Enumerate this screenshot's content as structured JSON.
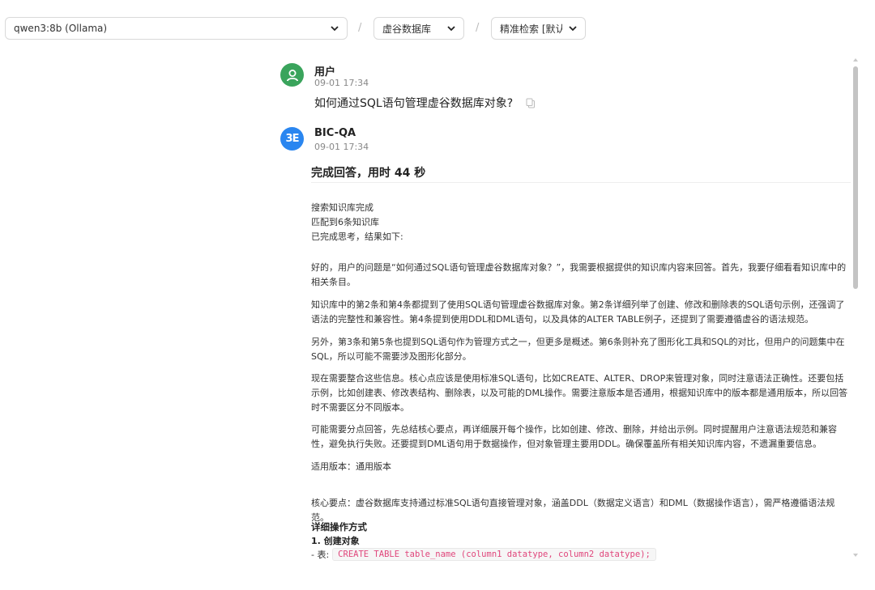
{
  "selectors": {
    "model": "qwen3:8b (Ollama)",
    "separator": "/",
    "database": "虚谷数据库",
    "mode": "精准检索 [默认]"
  },
  "user_message": {
    "name": "用户",
    "time": "09-01 17:34",
    "text": "如何通过SQL语句管理虚谷数据库对象?"
  },
  "bot_message": {
    "name": "BIC-QA",
    "avatar_text": "3E",
    "time": "09-01 17:34",
    "done": "完成回答，用时 44 秒",
    "status": [
      "搜索知识库完成",
      "匹配到6条知识库",
      "已完成思考，结果如下:"
    ],
    "paragraphs": [
      "好的，用户的问题是“如何通过SQL语句管理虚谷数据库对象？”，我需要根据提供的知识库内容来回答。首先，我要仔细看看知识库中的相关条目。",
      "知识库中的第2条和第4条都提到了使用SQL语句管理虚谷数据库对象。第2条详细列举了创建、修改和删除表的SQL语句示例，还强调了语法的完整性和兼容性。第4条提到使用DDL和DML语句，以及具体的ALTER TABLE例子，还提到了需要遵循虚谷的语法规范。",
      "另外，第3条和第5条也提到SQL语句作为管理方式之一，但更多是概述。第6条则补充了图形化工具和SQL的对比，但用户的问题集中在SQL，所以可能不需要涉及图形化部分。",
      "现在需要整合这些信息。核心点应该是使用标准SQL语句，比如CREATE、ALTER、DROP来管理对象，同时注意语法正确性。还要包括示例，比如创建表、修改表结构、删除表，以及可能的DML操作。需要注意版本是否通用，根据知识库中的版本都是通用版本，所以回答时不需要区分不同版本。",
      "可能需要分点回答，先总结核心要点，再详细展开每个操作，比如创建、修改、删除，并给出示例。同时提醒用户注意语法规范和兼容性，避免执行失败。还要提到DML语句用于数据操作，但对象管理主要用DDL。确保覆盖所有相关知识库内容，不遗漏重要信息。",
      "适用版本：通用版本",
      "核心要点：虚谷数据库支持通过标准SQL语句直接管理对象，涵盖DDL（数据定义语言）和DML（数据操作语言），需严格遵循语法规范。"
    ],
    "detail_heading": "详细操作方式",
    "sub_heading": "1. 创建对象",
    "code_prefix": "- 表:",
    "code": "CREATE TABLE table_name (column1 datatype, column2 datatype);"
  }
}
